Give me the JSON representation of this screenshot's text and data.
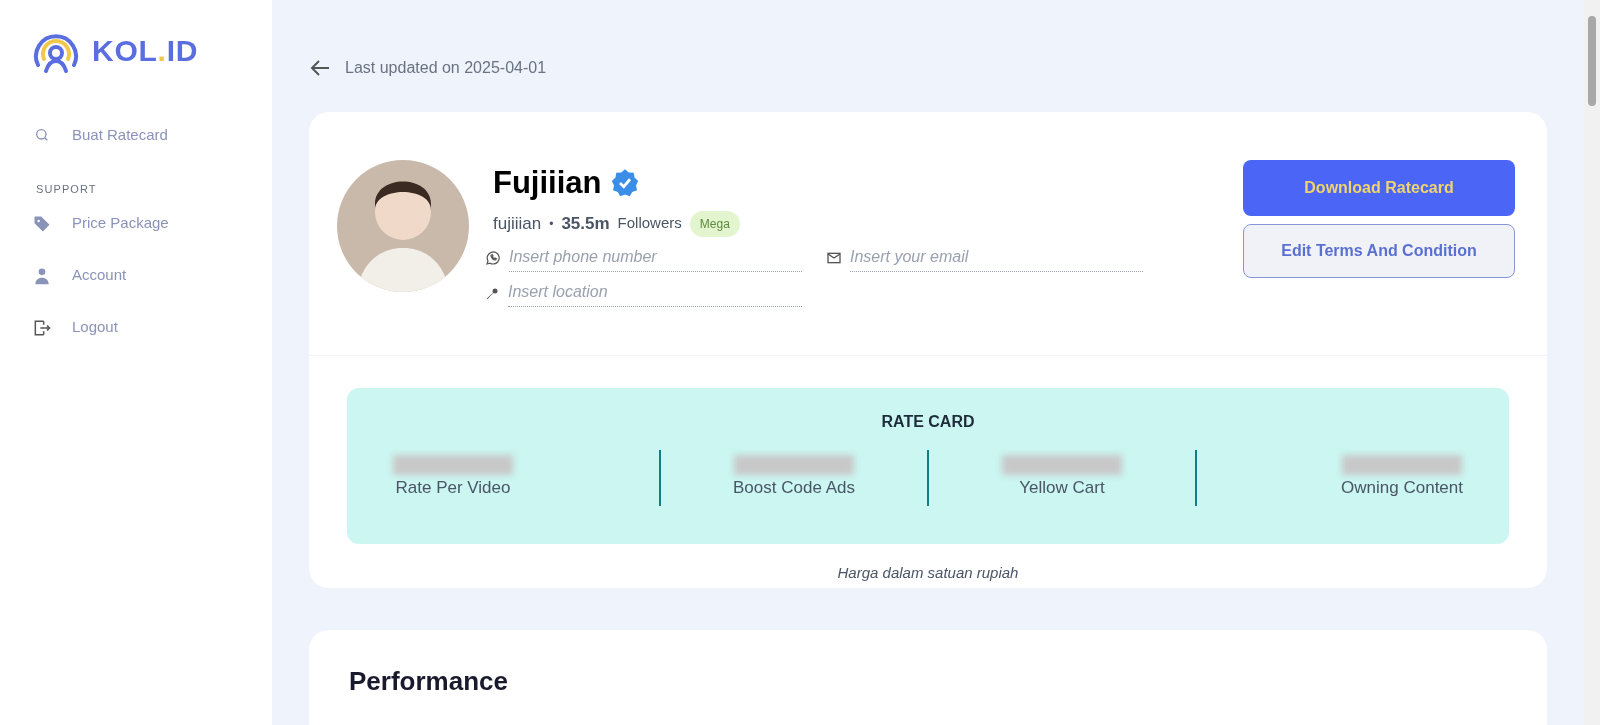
{
  "logo": {
    "text": "KOL",
    "dot": ".",
    "suffix": "ID"
  },
  "sidebar": {
    "items": [
      {
        "kind": "search",
        "label": "Buat Ratecard"
      }
    ],
    "section": "SUPPORT",
    "support_items": [
      {
        "kind": "tag",
        "label": "Price Package"
      },
      {
        "kind": "user",
        "label": "Account"
      },
      {
        "kind": "logout",
        "label": "Logout"
      }
    ]
  },
  "header": {
    "updated": "Last updated on 2025-04-01"
  },
  "profile": {
    "name": "Fujiiian",
    "verified": true,
    "username": "fujiiian",
    "separator": "•",
    "followers": "35.5m",
    "followers_label": "Followers",
    "tier": "Mega",
    "fields": [
      {
        "kind": "phone",
        "placeholder": "Insert phone number"
      },
      {
        "kind": "email",
        "placeholder": "Insert your email"
      },
      {
        "kind": "location",
        "placeholder": "Insert location"
      }
    ],
    "buttons": [
      {
        "kind": "primary",
        "label": "Download Ratecard"
      },
      {
        "kind": "secondary",
        "label": "Edit Terms And Condition"
      }
    ]
  },
  "rate_card": {
    "title": "RATE CARD",
    "items": [
      {
        "label": "Rate Per Video"
      },
      {
        "label": "Boost Code Ads"
      },
      {
        "label": "Yellow Cart"
      },
      {
        "label": "Owning Content"
      }
    ],
    "note": "Harga dalam satuan rupiah"
  },
  "performance": {
    "title": "Performance"
  }
}
